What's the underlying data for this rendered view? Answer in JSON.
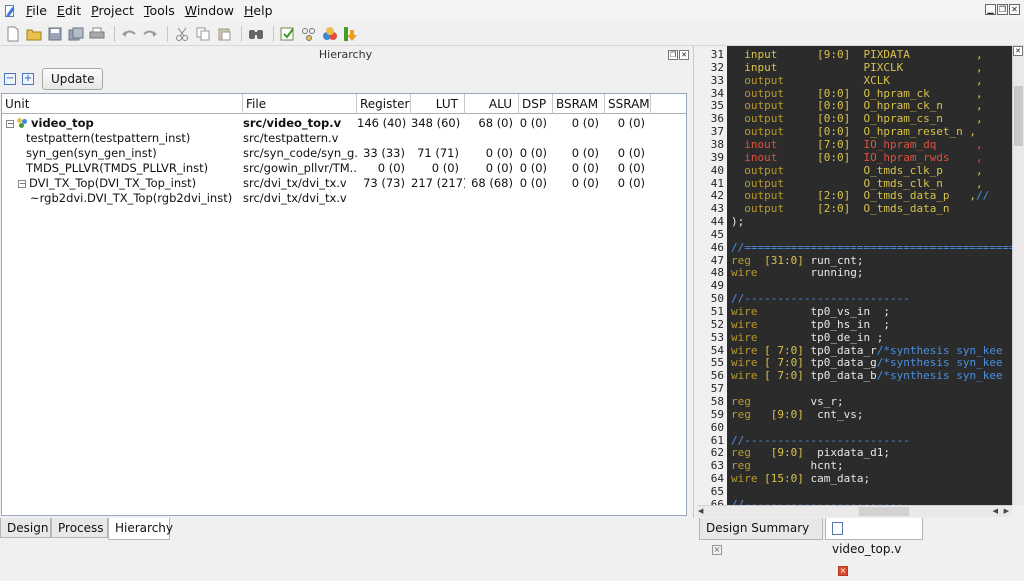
{
  "menubar": {
    "items": [
      "File",
      "Edit",
      "Project",
      "Tools",
      "Window",
      "Help"
    ],
    "underline": [
      "F",
      "E",
      "P",
      "T",
      "W",
      "H"
    ]
  },
  "toolbar": {
    "icons": [
      "new-file-icon",
      "open-folder-icon",
      "save-icon",
      "save-all-icon",
      "print-icon",
      "undo-icon",
      "redo-icon",
      "cut-icon",
      "copy-icon",
      "paste-icon",
      "find-icon",
      "run-synthesis-icon",
      "settings-icon",
      "bug-icon",
      "download-icon"
    ]
  },
  "hierarchy_panel": {
    "title": "Hierarchy",
    "update_label": "Update",
    "collapse_all": "−",
    "expand_all": "+",
    "columns": [
      "Unit",
      "File",
      "Register",
      "LUT",
      "ALU",
      "DSP",
      "BSRAM",
      "SSRAM"
    ],
    "rows": [
      {
        "unit": "video_top",
        "file": "src/video_top.v",
        "register": "146 (40)",
        "lut": "348 (60)",
        "alu": "68 (0)",
        "dsp": "0 (0)",
        "bsram": "0 (0)",
        "ssram": "0 (0)",
        "level": 0,
        "expander": "−",
        "bold": true
      },
      {
        "unit": "testpattern(testpattern_inst)",
        "file": "src/testpattern.v",
        "register": "",
        "lut": "",
        "alu": "",
        "dsp": "",
        "bsram": "",
        "ssram": "",
        "level": 1,
        "expander": "",
        "bold": false
      },
      {
        "unit": "syn_gen(syn_gen_inst)",
        "file": "src/syn_code/syn_g...",
        "register": "33 (33)",
        "lut": "71 (71)",
        "alu": "0 (0)",
        "dsp": "0 (0)",
        "bsram": "0 (0)",
        "ssram": "0 (0)",
        "level": 1,
        "expander": "",
        "bold": false
      },
      {
        "unit": "TMDS_PLLVR(TMDS_PLLVR_inst)",
        "file": "src/gowin_pllvr/TM...",
        "register": "0 (0)",
        "lut": "0 (0)",
        "alu": "0 (0)",
        "dsp": "0 (0)",
        "bsram": "0 (0)",
        "ssram": "0 (0)",
        "level": 1,
        "expander": "",
        "bold": false
      },
      {
        "unit": "DVI_TX_Top(DVI_TX_Top_inst)",
        "file": "src/dvi_tx/dvi_tx.v",
        "register": "73 (73)",
        "lut": "217 (217)",
        "alu": "68 (68)",
        "dsp": "0 (0)",
        "bsram": "0 (0)",
        "ssram": "0 (0)",
        "level": 1,
        "expander": "−",
        "bold": false
      },
      {
        "unit": "~rgb2dvi.DVI_TX_Top(rgb2dvi_inst)",
        "file": "src/dvi_tx/dvi_tx.v",
        "register": "",
        "lut": "",
        "alu": "",
        "dsp": "",
        "bsram": "",
        "ssram": "",
        "level": 2,
        "expander": "",
        "bold": false
      }
    ]
  },
  "left_tabs": [
    "Design",
    "Process",
    "Hierarchy"
  ],
  "left_active_tab": "Hierarchy",
  "editor": {
    "line_numbers": [
      "31",
      "32",
      "33",
      "34",
      "35",
      "36",
      "37",
      "38",
      "39",
      "40",
      "41",
      "42",
      "43",
      "44",
      "45",
      "46",
      "47",
      "48",
      "49",
      "50",
      "51",
      "52",
      "53",
      "54",
      "55",
      "56",
      "57",
      "58",
      "59",
      "60",
      "61",
      "62",
      "63",
      "64",
      "65",
      "66"
    ],
    "lines": [
      [
        {
          "t": "  input      ",
          "c": "kw"
        },
        {
          "t": "[9:0]",
          "c": "rg"
        },
        {
          "t": "  PIXDATA          ,",
          "c": "id"
        }
      ],
      [
        {
          "t": "  input             ",
          "c": "kw"
        },
        {
          "t": "PIXCLK           ,",
          "c": "id"
        }
      ],
      [
        {
          "t": "  output            ",
          "c": "kw2"
        },
        {
          "t": "XCLK             ,",
          "c": "id"
        }
      ],
      [
        {
          "t": "  output     ",
          "c": "kw2"
        },
        {
          "t": "[0:0]",
          "c": "rg"
        },
        {
          "t": "  O_hpram_ck       ,",
          "c": "id"
        }
      ],
      [
        {
          "t": "  output     ",
          "c": "kw2"
        },
        {
          "t": "[0:0]",
          "c": "rg"
        },
        {
          "t": "  O_hpram_ck_n     ,",
          "c": "id"
        }
      ],
      [
        {
          "t": "  output     ",
          "c": "kw2"
        },
        {
          "t": "[0:0]",
          "c": "rg"
        },
        {
          "t": "  O_hpram_cs_n     ,",
          "c": "id"
        }
      ],
      [
        {
          "t": "  output     ",
          "c": "kw2"
        },
        {
          "t": "[0:0]",
          "c": "rg"
        },
        {
          "t": "  O_hpram_reset_n ,",
          "c": "id"
        }
      ],
      [
        {
          "t": "  inout      ",
          "c": "io"
        },
        {
          "t": "[7:0]",
          "c": "rg"
        },
        {
          "t": "  IO_hpram_dq      ,",
          "c": "io"
        }
      ],
      [
        {
          "t": "  inout      ",
          "c": "io"
        },
        {
          "t": "[0:0]",
          "c": "rg"
        },
        {
          "t": "  IO_hpram_rwds    ,",
          "c": "io"
        }
      ],
      [
        {
          "t": "  output            ",
          "c": "kw2"
        },
        {
          "t": "O_tmds_clk_p     ,",
          "c": "id"
        }
      ],
      [
        {
          "t": "  output            ",
          "c": "kw2"
        },
        {
          "t": "O_tmds_clk_n     ,",
          "c": "id"
        }
      ],
      [
        {
          "t": "  output     ",
          "c": "kw2"
        },
        {
          "t": "[2:0]",
          "c": "rg"
        },
        {
          "t": "  O_tmds_data_p   ,",
          "c": "id"
        },
        {
          "t": "//",
          "c": "cm"
        }
      ],
      [
        {
          "t": "  output     ",
          "c": "kw2"
        },
        {
          "t": "[2:0]",
          "c": "rg"
        },
        {
          "t": "  O_tmds_data_n",
          "c": "id"
        }
      ],
      [
        {
          "t": ");",
          "c": "pl"
        }
      ],
      [
        {
          "t": "",
          "c": "pl"
        }
      ],
      [
        {
          "t": "//==========================================",
          "c": "cm"
        }
      ],
      [
        {
          "t": "reg  ",
          "c": "kw2"
        },
        {
          "t": "[31:0]",
          "c": "rg"
        },
        {
          "t": " run_cnt;",
          "c": "pl"
        }
      ],
      [
        {
          "t": "wire        ",
          "c": "kw2"
        },
        {
          "t": "running;",
          "c": "pl"
        }
      ],
      [
        {
          "t": "",
          "c": "pl"
        }
      ],
      [
        {
          "t": "//-------------------------",
          "c": "cm"
        }
      ],
      [
        {
          "t": "wire        ",
          "c": "kw2"
        },
        {
          "t": "tp0_vs_in  ;",
          "c": "pl"
        }
      ],
      [
        {
          "t": "wire        ",
          "c": "kw2"
        },
        {
          "t": "tp0_hs_in  ;",
          "c": "pl"
        }
      ],
      [
        {
          "t": "wire        ",
          "c": "kw2"
        },
        {
          "t": "tp0_de_in ;",
          "c": "pl"
        }
      ],
      [
        {
          "t": "wire ",
          "c": "kw2"
        },
        {
          "t": "[ 7:0]",
          "c": "rg"
        },
        {
          "t": " tp0_data_r",
          "c": "pl"
        },
        {
          "t": "/*synthesis syn_kee",
          "c": "cm"
        }
      ],
      [
        {
          "t": "wire ",
          "c": "kw2"
        },
        {
          "t": "[ 7:0]",
          "c": "rg"
        },
        {
          "t": " tp0_data_g",
          "c": "pl"
        },
        {
          "t": "/*synthesis syn_kee",
          "c": "cm"
        }
      ],
      [
        {
          "t": "wire ",
          "c": "kw2"
        },
        {
          "t": "[ 7:0]",
          "c": "rg"
        },
        {
          "t": " tp0_data_b",
          "c": "pl"
        },
        {
          "t": "/*synthesis syn_kee",
          "c": "cm"
        }
      ],
      [
        {
          "t": "",
          "c": "pl"
        }
      ],
      [
        {
          "t": "reg         ",
          "c": "kw2"
        },
        {
          "t": "vs_r;",
          "c": "pl"
        }
      ],
      [
        {
          "t": "reg   ",
          "c": "kw2"
        },
        {
          "t": "[9:0]",
          "c": "rg"
        },
        {
          "t": "  cnt_vs;",
          "c": "pl"
        }
      ],
      [
        {
          "t": "",
          "c": "pl"
        }
      ],
      [
        {
          "t": "//-------------------------",
          "c": "cm"
        }
      ],
      [
        {
          "t": "reg   ",
          "c": "kw2"
        },
        {
          "t": "[9:0]",
          "c": "rg"
        },
        {
          "t": "  pixdata_d1;",
          "c": "pl"
        }
      ],
      [
        {
          "t": "reg         ",
          "c": "kw2"
        },
        {
          "t": "hcnt;",
          "c": "pl"
        }
      ],
      [
        {
          "t": "wire ",
          "c": "kw2"
        },
        {
          "t": "[15:0]",
          "c": "rg"
        },
        {
          "t": " cam_data;",
          "c": "pl"
        }
      ],
      [
        {
          "t": "",
          "c": "pl"
        }
      ],
      [
        {
          "t": "//------------------------",
          "c": "cm"
        }
      ]
    ],
    "colors": {
      "kw": "#d8c24a",
      "kw2": "#b89a2c",
      "rg": "#d8c24a",
      "id": "#d8c24a",
      "io": "#e0503c",
      "cm": "#4a8fe0",
      "pl": "#e8e8e8"
    }
  },
  "right_tabs": [
    "Design Summary",
    "video_top.v"
  ],
  "right_active_tab": "video_top.v"
}
